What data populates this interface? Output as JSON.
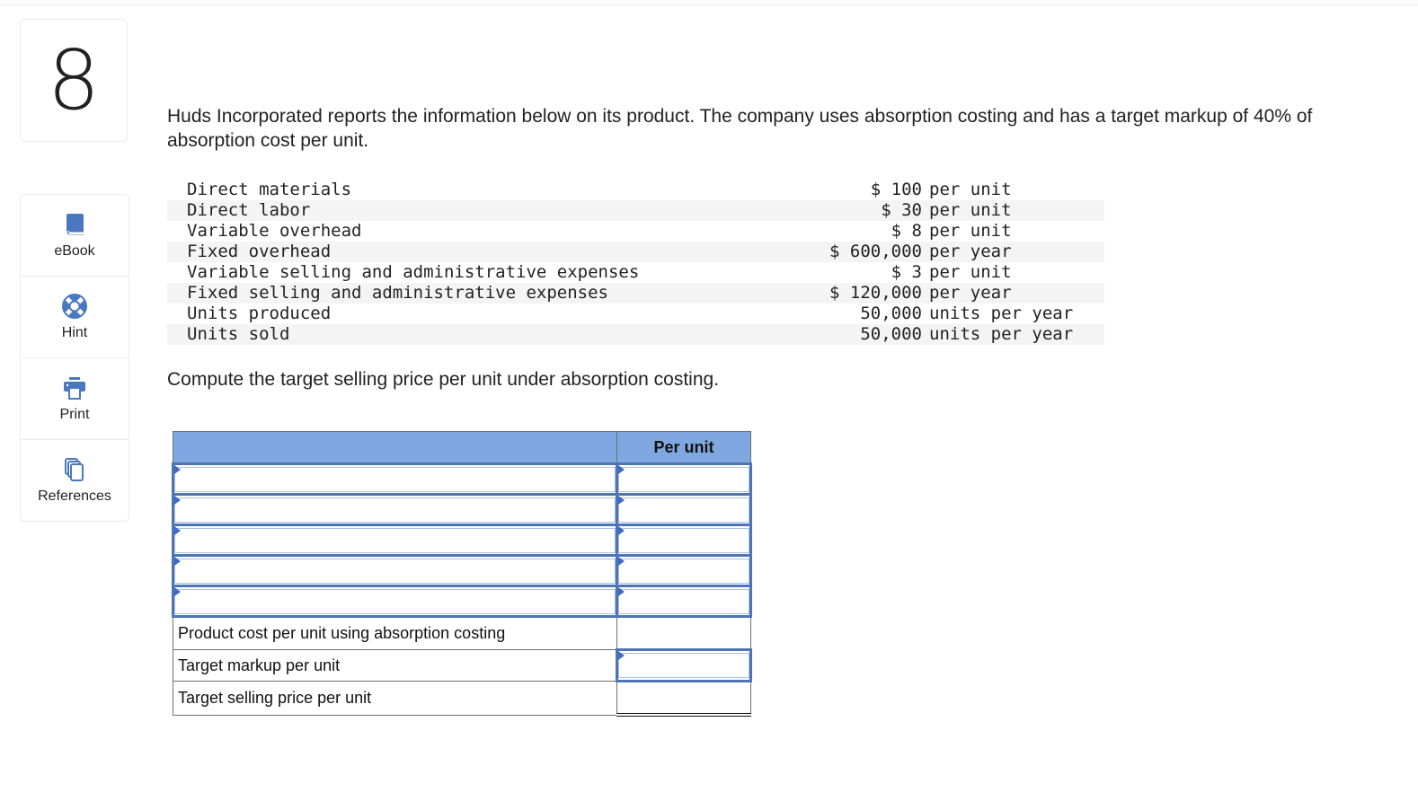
{
  "question_number": "8",
  "tools": [
    {
      "label": "eBook",
      "icon": "book-icon"
    },
    {
      "label": "Hint",
      "icon": "lifebuoy-icon"
    },
    {
      "label": "Print",
      "icon": "printer-icon"
    },
    {
      "label": "References",
      "icon": "documents-icon"
    }
  ],
  "intro": "Huds Incorporated reports the information below on its product. The company uses absorption costing and has a target markup of 40% of absorption cost per unit.",
  "givens": [
    {
      "label": "Direct materials",
      "amount": "$ 100",
      "unit": "per unit"
    },
    {
      "label": "Direct labor",
      "amount": "$ 30",
      "unit": "per unit"
    },
    {
      "label": "Variable overhead",
      "amount": "$ 8",
      "unit": "per unit"
    },
    {
      "label": "Fixed overhead",
      "amount": "$ 600,000",
      "unit": "per year"
    },
    {
      "label": "Variable selling and administrative expenses",
      "amount": "$ 3",
      "unit": "per unit"
    },
    {
      "label": "Fixed selling and administrative expenses",
      "amount": "$ 120,000",
      "unit": "per year"
    },
    {
      "label": "Units produced",
      "amount": "50,000",
      "unit": "units per year"
    },
    {
      "label": "Units sold",
      "amount": "50,000",
      "unit": "units per year"
    }
  ],
  "prompt": "Compute the target selling price per unit under absorption costing.",
  "answer_table": {
    "header_left": "",
    "header_right": "Per unit",
    "input_rows": [
      {
        "label_value": "",
        "amount_value": ""
      },
      {
        "label_value": "",
        "amount_value": ""
      },
      {
        "label_value": "",
        "amount_value": ""
      },
      {
        "label_value": "",
        "amount_value": ""
      },
      {
        "label_value": "",
        "amount_value": ""
      }
    ],
    "summary_rows": [
      {
        "label": "Product cost per unit using absorption costing",
        "value": ""
      },
      {
        "label": "Target markup per unit",
        "value": ""
      },
      {
        "label": "Target selling price per unit",
        "value": ""
      }
    ]
  },
  "colors": {
    "header_bg": "#7fa8e0",
    "input_border": "#4f74b4",
    "icon_blue": "#4a78c0"
  }
}
